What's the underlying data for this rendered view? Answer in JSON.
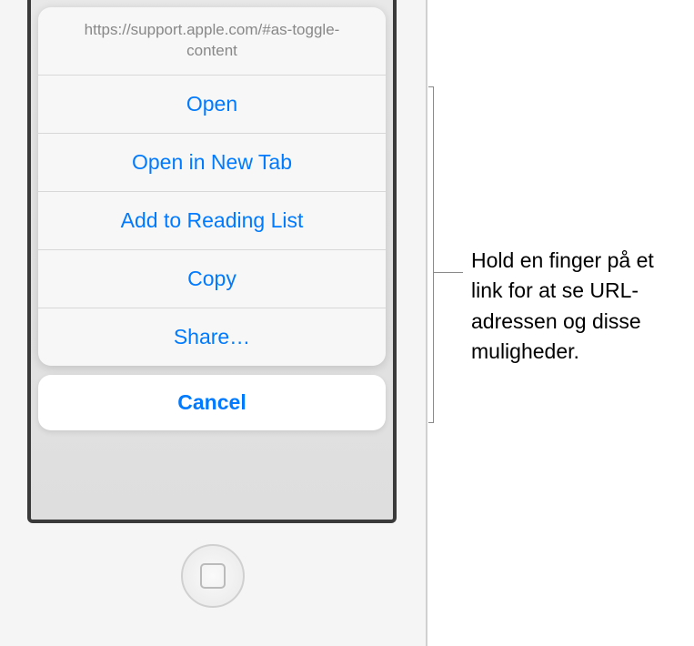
{
  "url_header": "https://support.apple.com/#as-toggle-content",
  "actions": {
    "open": "Open",
    "open_new_tab": "Open in New Tab",
    "add_reading_list": "Add to Reading List",
    "copy": "Copy",
    "share": "Share…"
  },
  "cancel": "Cancel",
  "callout": "Hold en finger på et link for at se URL-adressen og disse muligheder."
}
